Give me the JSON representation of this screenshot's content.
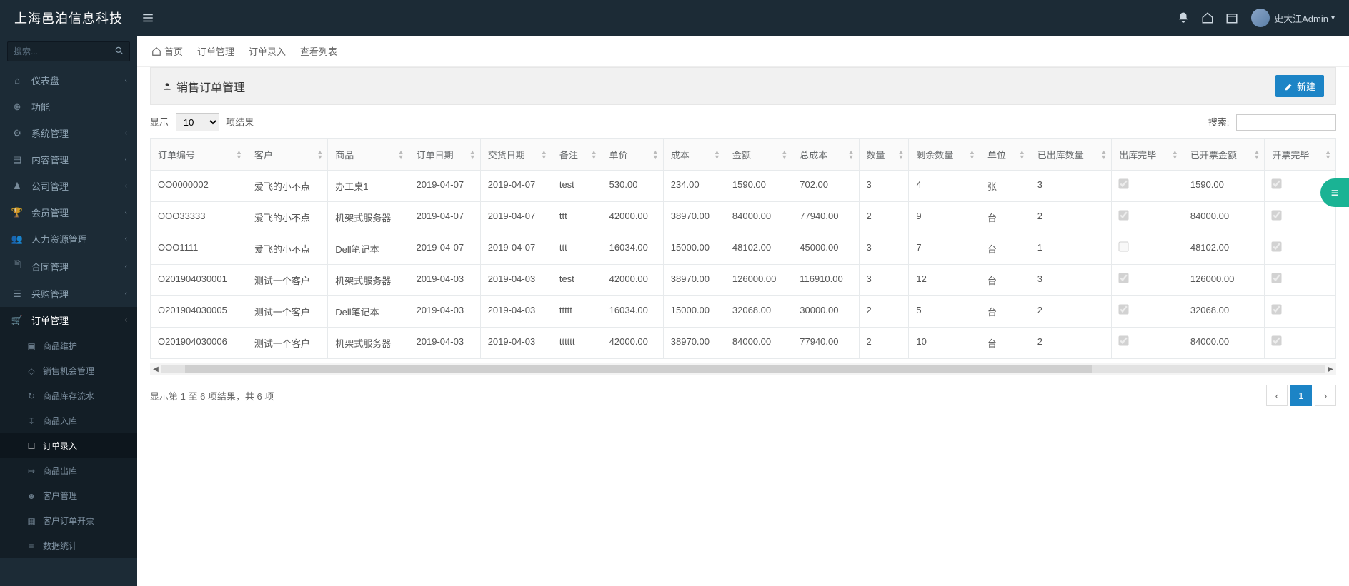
{
  "brand": "上海邑泊信息科技",
  "search_placeholder": "搜索...",
  "user_name": "史大江Admin",
  "nav": [
    {
      "icon": "home",
      "label": "仪表盘",
      "expand": false
    },
    {
      "icon": "globe",
      "label": "功能",
      "expand": false,
      "noarrow": true
    },
    {
      "icon": "cogs",
      "label": "系统管理",
      "expand": true
    },
    {
      "icon": "content",
      "label": "内容管理",
      "expand": true
    },
    {
      "icon": "company",
      "label": "公司管理",
      "expand": true
    },
    {
      "icon": "trophy",
      "label": "会员管理",
      "expand": true
    },
    {
      "icon": "people",
      "label": "人力资源管理",
      "expand": true
    },
    {
      "icon": "contract",
      "label": "合同管理",
      "expand": true
    },
    {
      "icon": "purchase",
      "label": "采购管理",
      "expand": true
    },
    {
      "icon": "cart",
      "label": "订单管理",
      "expand": true,
      "active": true
    }
  ],
  "subnav": [
    {
      "icon": "cube",
      "label": "商品维护"
    },
    {
      "icon": "chance",
      "label": "销售机会管理"
    },
    {
      "icon": "flow",
      "label": "商品库存流水"
    },
    {
      "icon": "in",
      "label": "商品入库"
    },
    {
      "icon": "order",
      "label": "订单录入",
      "current": true
    },
    {
      "icon": "out",
      "label": "商品出库"
    },
    {
      "icon": "cust",
      "label": "客户管理"
    },
    {
      "icon": "inv",
      "label": "客户订单开票"
    },
    {
      "icon": "stat",
      "label": "数据统计"
    }
  ],
  "breadcrumb": [
    "首页",
    "订单管理",
    "订单录入",
    "查看列表"
  ],
  "page_title": "销售订单管理",
  "new_btn": "新建",
  "show_label_left": "显示",
  "show_label_right": "项结果",
  "page_size": "10",
  "search_label": "搜索:",
  "columns": [
    "订单编号",
    "客户",
    "商品",
    "订单日期",
    "交货日期",
    "备注",
    "单价",
    "成本",
    "金额",
    "总成本",
    "数量",
    "剩余数量",
    "单位",
    "已出库数量",
    "出库完毕",
    "已开票金额",
    "开票完毕"
  ],
  "rows": [
    {
      "id": "OO0000002",
      "cust": "爱飞的小不点",
      "prod": "办工桌1",
      "od": "2019-04-07",
      "dd": "2019-04-07",
      "memo": "test",
      "price": "530.00",
      "cost": "234.00",
      "amt": "1590.00",
      "tcost": "702.00",
      "qty": "3",
      "remain": "4",
      "unit": "张",
      "outqty": "3",
      "outdone": true,
      "invamt": "1590.00",
      "invdone": true
    },
    {
      "id": "OOO33333",
      "cust": "爱飞的小不点",
      "prod": "机架式服务器",
      "od": "2019-04-07",
      "dd": "2019-04-07",
      "memo": "ttt",
      "price": "42000.00",
      "cost": "38970.00",
      "amt": "84000.00",
      "tcost": "77940.00",
      "qty": "2",
      "remain": "9",
      "unit": "台",
      "outqty": "2",
      "outdone": true,
      "invamt": "84000.00",
      "invdone": true
    },
    {
      "id": "OOO1111",
      "cust": "爱飞的小不点",
      "prod": "Dell笔记本",
      "od": "2019-04-07",
      "dd": "2019-04-07",
      "memo": "ttt",
      "price": "16034.00",
      "cost": "15000.00",
      "amt": "48102.00",
      "tcost": "45000.00",
      "qty": "3",
      "remain": "7",
      "unit": "台",
      "outqty": "1",
      "outdone": false,
      "invamt": "48102.00",
      "invdone": true
    },
    {
      "id": "O201904030001",
      "cust": "测试一个客户",
      "prod": "机架式服务器",
      "od": "2019-04-03",
      "dd": "2019-04-03",
      "memo": "test",
      "price": "42000.00",
      "cost": "38970.00",
      "amt": "126000.00",
      "tcost": "116910.00",
      "qty": "3",
      "remain": "12",
      "unit": "台",
      "outqty": "3",
      "outdone": true,
      "invamt": "126000.00",
      "invdone": true
    },
    {
      "id": "O201904030005",
      "cust": "测试一个客户",
      "prod": "Dell笔记本",
      "od": "2019-04-03",
      "dd": "2019-04-03",
      "memo": "ttttt",
      "price": "16034.00",
      "cost": "15000.00",
      "amt": "32068.00",
      "tcost": "30000.00",
      "qty": "2",
      "remain": "5",
      "unit": "台",
      "outqty": "2",
      "outdone": true,
      "invamt": "32068.00",
      "invdone": true
    },
    {
      "id": "O201904030006",
      "cust": "测试一个客户",
      "prod": "机架式服务器",
      "od": "2019-04-03",
      "dd": "2019-04-03",
      "memo": "tttttt",
      "price": "42000.00",
      "cost": "38970.00",
      "amt": "84000.00",
      "tcost": "77940.00",
      "qty": "2",
      "remain": "10",
      "unit": "台",
      "outqty": "2",
      "outdone": true,
      "invamt": "84000.00",
      "invdone": true
    }
  ],
  "footer_info": "显示第 1 至 6 项结果，共 6 项",
  "pager_current": "1"
}
